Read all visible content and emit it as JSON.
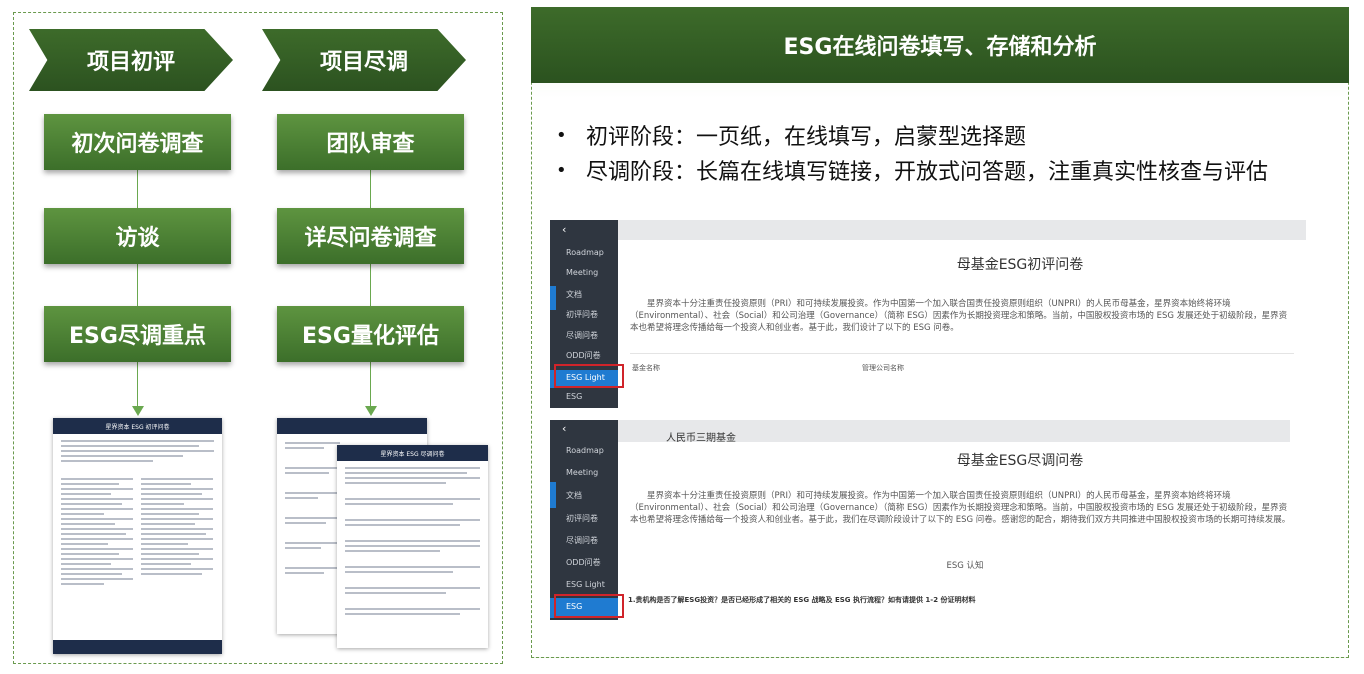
{
  "left": {
    "stages": [
      "项目初评",
      "项目尽调"
    ],
    "col1": [
      "初次问卷调查",
      "访谈",
      "ESG尽调重点"
    ],
    "col2": [
      "团队审查",
      "详尽问卷调查",
      "ESG量化评估"
    ],
    "doc1_title": "星界资本 ESG 初评问卷",
    "doc2_title": "星界资本 ESG 尽调问卷"
  },
  "right": {
    "title": "ESG在线问卷填写、存储和分析",
    "bullets": [
      "初评阶段：一页纸，在线填写，启蒙型选择题",
      "尽调阶段：长篇在线填写链接，开放式问答题，注重真实性核查与评估"
    ],
    "shot1": {
      "menu": [
        "Roadmap",
        "Meeting",
        "文档",
        "初评问卷",
        "尽调问卷",
        "ODD问卷",
        "ESG Light",
        "ESG"
      ],
      "title": "母基金ESG初评问卷",
      "body": "星界资本十分注重责任投资原则（PRI）和可持续发展投资。作为中国第一个加入联合国责任投资原则组织（UNPRI）的人民币母基金，星界资本始终将环境（Environmental）、社会（Social）和公司治理（Governance）（简称 ESG）因素作为长期投资理念和策略。当前，中国股权投资市场的 ESG 发展还处于初级阶段，星界资本也希望将理念传播给每一个投资人和创业者。基于此，我们设计了以下的 ESG 问卷。",
      "field1": "基金名称",
      "field2": "管理公司名称"
    },
    "shot2": {
      "fund": "人民币三期基金",
      "menu": [
        "Roadmap",
        "Meeting",
        "文档",
        "初评问卷",
        "尽调问卷",
        "ODD问卷",
        "ESG Light",
        "ESG"
      ],
      "title": "母基金ESG尽调问卷",
      "body": "星界资本十分注重责任投资原则（PRI）和可持续发展投资。作为中国第一个加入联合国责任投资原则组织（UNPRI）的人民币母基金，星界资本始终将环境（Environmental）、社会（Social）和公司治理（Governance）（简称 ESG）因素作为长期投资理念和策略。当前，中国股权投资市场的 ESG 发展还处于初级阶段，星界资本也希望将理念传播给每一个投资人和创业者。基于此，我们在尽调阶段设计了以下的 ESG 问卷。感谢您的配合，期待我们双方共同推进中国股权投资市场的长期可持续发展。",
      "section": "ESG 认知",
      "question": "1.贵机构是否了解ESG投资？是否已经形成了相关的 ESG 战略及 ESG 执行流程？如有请提供 1-2 份证明材料"
    }
  }
}
